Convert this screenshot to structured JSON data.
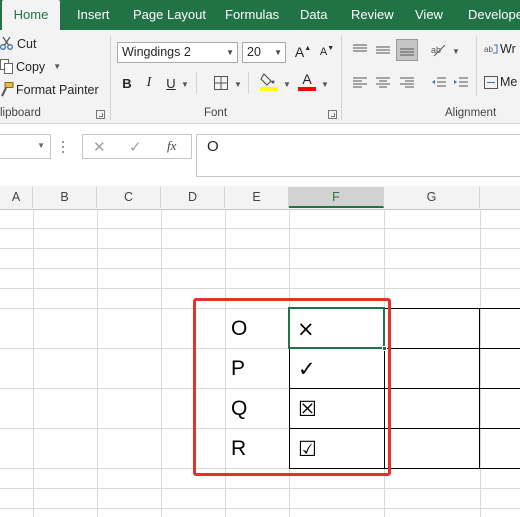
{
  "ribbon_tabs": [
    "Home",
    "Insert",
    "Page Layout",
    "Formulas",
    "Data",
    "Review",
    "View",
    "Developer"
  ],
  "clipboard": {
    "cut_label": "Cut",
    "copy_label": "Copy",
    "format_painter_label": "Format Painter",
    "group_label": "lipboard"
  },
  "font": {
    "font_name": "Wingdings 2",
    "font_size": "20",
    "bold": "B",
    "italic": "I",
    "underline": "U",
    "grow": "A",
    "shrink": "A",
    "font_color_letter": "A",
    "group_label": "Font",
    "highlight_color": "#ffff00",
    "font_color": "#ff0000"
  },
  "alignment": {
    "group_label": "Alignment",
    "wrap_text": "Wr",
    "merge": "Me"
  },
  "formula_bar": {
    "fx": "fx",
    "cancel": "✕",
    "enter": "✓",
    "content": "O"
  },
  "columns": [
    "A",
    "B",
    "C",
    "D",
    "E",
    "F",
    "G"
  ],
  "selected_column": "F",
  "table": [
    {
      "letter": "O",
      "symbol": "×"
    },
    {
      "letter": "P",
      "symbol": "✓"
    },
    {
      "letter": "Q",
      "symbol": "☒"
    },
    {
      "letter": "R",
      "symbol": "☑"
    }
  ],
  "colors": {
    "accent": "#217346",
    "highlight_box": "#e3322b"
  }
}
